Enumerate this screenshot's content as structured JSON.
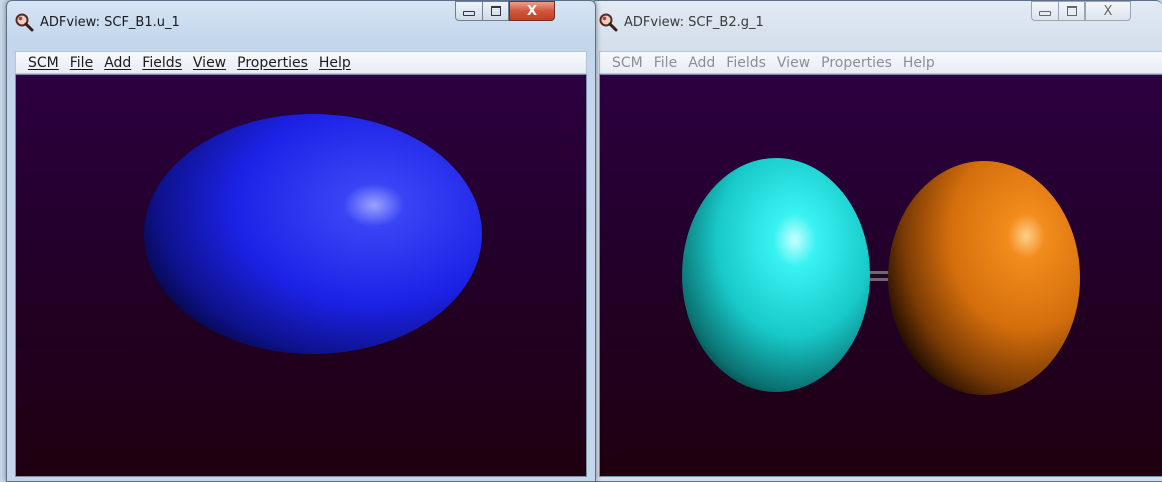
{
  "windows": [
    {
      "title": "ADFview: SCF_B1.u_1",
      "active": true,
      "menu": [
        "SCM",
        "File",
        "Add",
        "Fields",
        "View",
        "Properties",
        "Help"
      ],
      "orbital": {
        "lobe_color": "#1c22e6"
      }
    },
    {
      "title": "ADFview: SCF_B2.g_1",
      "active": false,
      "menu": [
        "SCM",
        "File",
        "Add",
        "Fields",
        "View",
        "Properties",
        "Help"
      ],
      "orbital": {
        "left_lobe_color": "#22e0e0",
        "right_lobe_color": "#e07a10"
      }
    }
  ],
  "caption_buttons": {
    "close_glyph": "X",
    "icons": [
      "minimize-icon",
      "maximize-icon",
      "close-icon"
    ]
  },
  "colors": {
    "viewport_top": "#2c0040",
    "viewport_bottom": "#1e000f"
  }
}
